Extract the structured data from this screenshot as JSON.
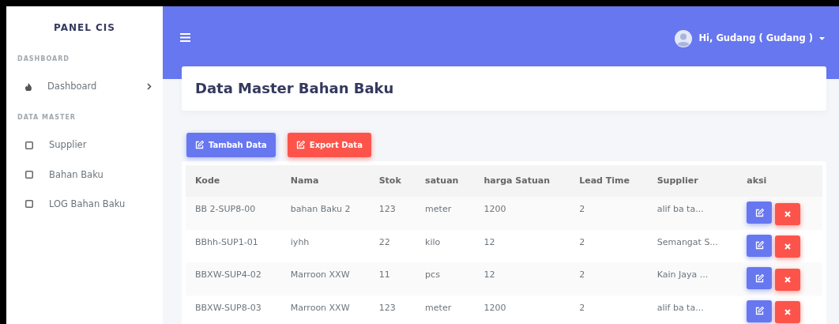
{
  "sidebar": {
    "brand": "PANEL CIS",
    "sections": [
      {
        "heading": "DASHBOARD",
        "items": [
          {
            "label": "Dashboard",
            "kind": "fire",
            "has_submenu": true
          }
        ]
      },
      {
        "heading": "DATA MASTER",
        "items": [
          {
            "label": "Supplier",
            "kind": "square",
            "has_submenu": false
          },
          {
            "label": "Bahan Baku",
            "kind": "square",
            "has_submenu": false
          },
          {
            "label": "LOG Bahan Baku",
            "kind": "square",
            "has_submenu": false
          }
        ]
      }
    ]
  },
  "topbar": {
    "user": "Hi, Gudang ( Gudang )"
  },
  "page_title": "Data Master Bahan Baku",
  "buttons": [
    {
      "label": "Tambah Data",
      "kind": "primary"
    },
    {
      "label": "Export Data",
      "kind": "danger"
    }
  ],
  "table": {
    "columns": [
      "Kode",
      "Nama",
      "Stok",
      "satuan",
      "harga Satuan",
      "Lead Time",
      "Supplier",
      "aksi"
    ],
    "rows": [
      [
        "BB 2-SUP8-00",
        "bahan Baku 2",
        "123",
        "meter",
        "1200",
        "2",
        "alif ba ta..."
      ],
      [
        "BBhh-SUP1-01",
        "iyhh",
        "22",
        "kilo",
        "12",
        "2",
        "Semangat S..."
      ],
      [
        "BBXW-SUP4-02",
        "Marroon XXW",
        "11",
        "pcs",
        "12",
        "2",
        "Kain Jaya ..."
      ],
      [
        "BBXW-SUP8-03",
        "Marroon XXW",
        "123",
        "meter",
        "1200",
        "2",
        "alif ba ta..."
      ]
    ]
  }
}
